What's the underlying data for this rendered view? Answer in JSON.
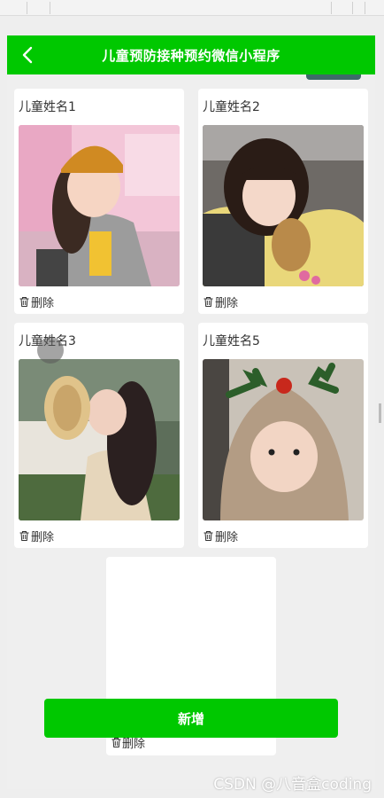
{
  "navbar": {
    "title": "儿童预防接种预约微信小程序",
    "back_icon": "chevron-left-icon"
  },
  "children": [
    {
      "name": "儿童姓名1",
      "delete_label": "删除"
    },
    {
      "name": "儿童姓名2",
      "delete_label": "删除"
    },
    {
      "name": "儿童姓名3",
      "delete_label": "删除"
    },
    {
      "name": "儿童姓名5",
      "delete_label": "删除"
    }
  ],
  "empty_card": {
    "delete_label": "删除"
  },
  "add_button": {
    "label": "新增"
  },
  "watermark": "CSDN @八音盒coding",
  "colors": {
    "accent": "#00c800",
    "background": "#efefef",
    "card": "#ffffff"
  }
}
